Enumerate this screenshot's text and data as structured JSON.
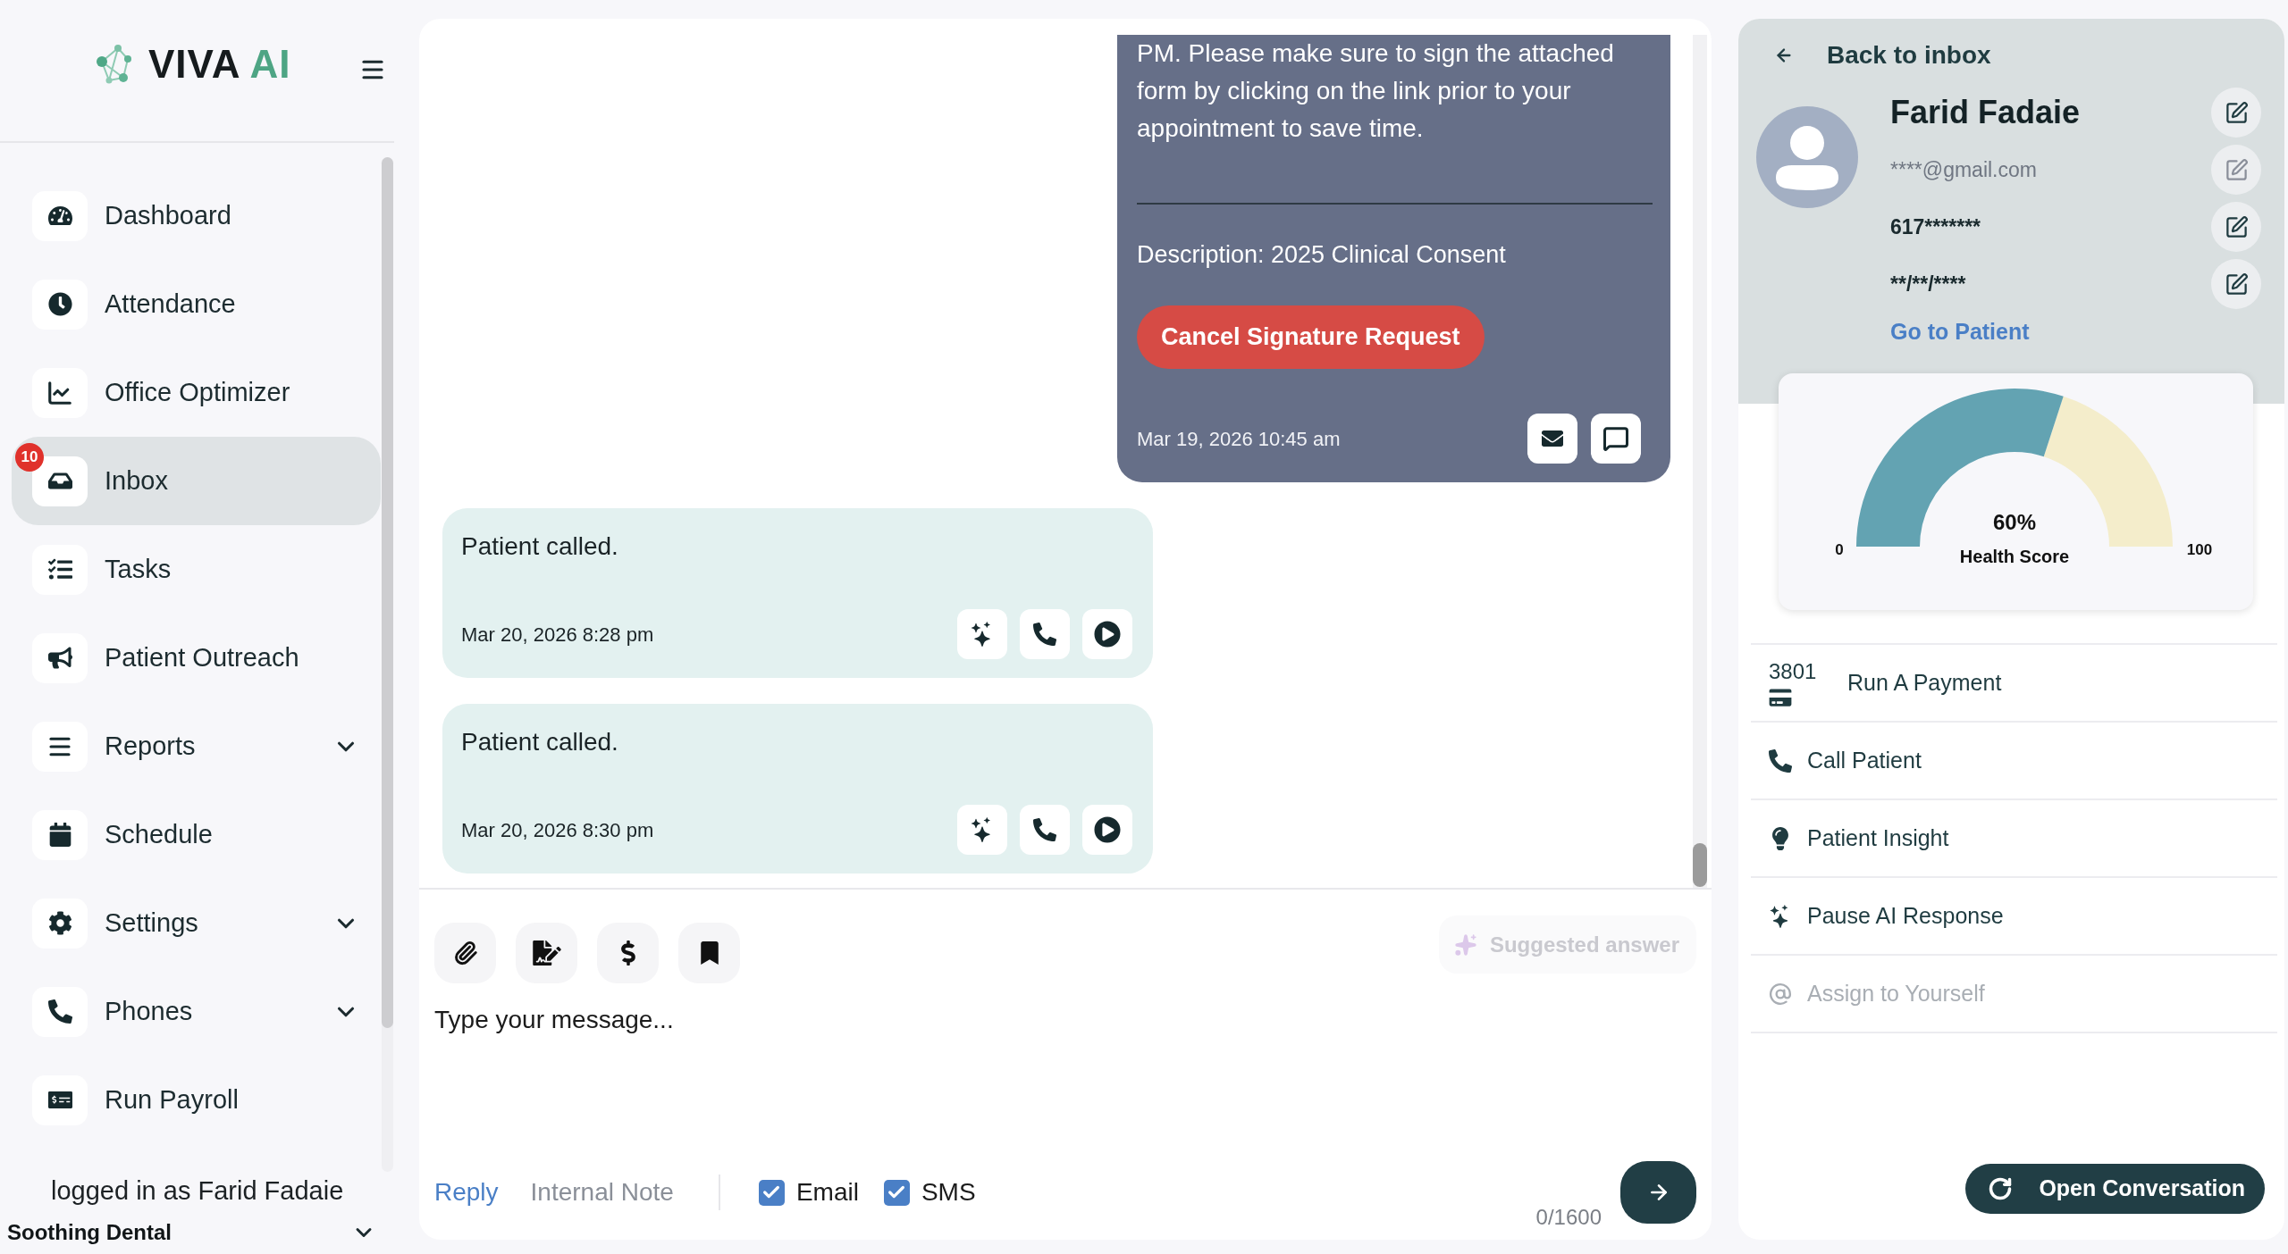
{
  "sidebar": {
    "logo": {
      "word": "VIVA",
      "accent": "AI"
    },
    "nav_items": [
      {
        "label": "Dashboard",
        "selected": false
      },
      {
        "label": "Attendance",
        "selected": false
      },
      {
        "label": "Office Optimizer",
        "selected": false
      },
      {
        "label": "Inbox",
        "selected": true,
        "badge": "10"
      },
      {
        "label": "Tasks",
        "selected": false
      },
      {
        "label": "Patient Outreach",
        "selected": false
      },
      {
        "label": "Reports",
        "selected": false,
        "expanded": false
      },
      {
        "label": "Schedule",
        "selected": false
      },
      {
        "label": "Settings",
        "selected": false,
        "expanded": false
      },
      {
        "label": "Phones",
        "selected": false,
        "expanded": false
      },
      {
        "label": "Run Payroll",
        "selected": false
      }
    ],
    "user_text": "logged in as Farid Fadaie",
    "organization": {
      "name": "Soothing Dental",
      "expanded": false
    }
  },
  "conversation": {
    "messages": [
      {
        "kind": "outgoing",
        "text": "PM. Please make sure to sign the attached form by clicking on the link prior to your appointment to save time.",
        "description": "Description: 2025 Clinical Consent",
        "action": "Cancel Signature Request",
        "timestamp": "Mar 19, 2026 10:45 am"
      },
      {
        "kind": "incoming",
        "text": "Patient called.",
        "timestamp": "Mar 20, 2026 8:28 pm"
      },
      {
        "kind": "incoming",
        "text": "Patient called.",
        "timestamp": "Mar 20, 2026 8:30 pm"
      }
    ]
  },
  "composer": {
    "suggested_answer": {
      "label": "Suggested answer",
      "disabled": true
    },
    "message": {
      "placeholder": "Type your message..."
    },
    "tabs": [
      {
        "label": "Reply",
        "selected": true
      },
      {
        "label": "Internal Note",
        "selected": false
      }
    ],
    "channels": [
      {
        "label": "Email",
        "checked": true
      },
      {
        "label": "SMS",
        "checked": true
      }
    ],
    "char_count": "0/1600"
  },
  "patient": {
    "back_label": "Back to inbox",
    "name": "Farid Fadaie",
    "fields": [
      {
        "value": "****@gmail.com",
        "muted": true
      },
      {
        "value": "617*******",
        "muted": false
      },
      {
        "value": "**/**/****",
        "muted": false
      }
    ],
    "link": "Go to Patient",
    "health_score": {
      "level": 0.6,
      "reading": "60%",
      "label": "Health Score",
      "min": "0",
      "max": "100"
    },
    "actions": [
      {
        "label": "Run A Payment",
        "card_digits": "3801",
        "disabled": false
      },
      {
        "label": "Call Patient",
        "disabled": false
      },
      {
        "label": "Patient Insight",
        "disabled": false
      },
      {
        "label": "Pause AI Response",
        "disabled": false
      },
      {
        "label": "Assign to Yourself",
        "disabled": true
      }
    ],
    "open_button": "Open Conversation"
  }
}
